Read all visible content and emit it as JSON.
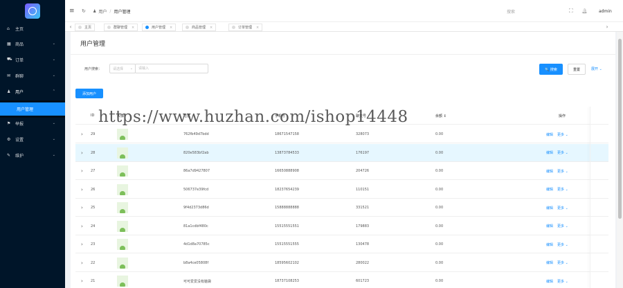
{
  "sidebar": {
    "items": [
      {
        "label": "主页",
        "icon": "home-icon",
        "glyph": "⌂",
        "arrow": ""
      },
      {
        "label": "商品",
        "icon": "goods-icon",
        "glyph": "▦",
        "arrow": "⌄"
      },
      {
        "label": "订单",
        "icon": "cart-icon",
        "glyph": "⛟",
        "arrow": "⌄"
      },
      {
        "label": "群聊",
        "icon": "chat-icon",
        "glyph": "✉",
        "arrow": "⌄"
      },
      {
        "label": "用户",
        "icon": "user-icon",
        "glyph": "♟",
        "arrow": "⌃"
      },
      {
        "label": "举报",
        "icon": "report-icon",
        "glyph": "⚑",
        "arrow": "⌄"
      },
      {
        "label": "设置",
        "icon": "settings-icon",
        "glyph": "⚙",
        "arrow": "⌄"
      },
      {
        "label": "维护",
        "icon": "wrench-icon",
        "glyph": "✎",
        "arrow": "⌄"
      }
    ],
    "sub_active": "用户管理"
  },
  "header": {
    "menu_icon": "≡",
    "refresh_icon": "↻",
    "crumb_parent": "用户",
    "crumb_sep": "/",
    "crumb_current": "用户管理",
    "search_label": "搜索",
    "fullscreen_icon": "⛶",
    "bell_icon": "🔔",
    "username": "admin"
  },
  "tabs": {
    "prev": "‹",
    "next": "›",
    "items": [
      {
        "label": "主页"
      },
      {
        "label": "群聊管理"
      },
      {
        "label": "用户管理"
      },
      {
        "label": "商品管理"
      },
      {
        "label": "订单管理"
      }
    ],
    "close": "×"
  },
  "page": {
    "title": "用户管理",
    "search_label": "用户搜索：",
    "select_value": "请选择",
    "select_chev": "⌄",
    "input_placeholder": "请输入",
    "search_button": "🔍 搜索",
    "reset_button": "重置",
    "expand_link": "展开 ⌄",
    "add_button": "添加用户",
    "watermark": "https://www.huzhan.com/ishop14448"
  },
  "table": {
    "headers": {
      "id": "ID",
      "avatar": "头像",
      "name": "姓名",
      "phone": "手机号",
      "account": "聊天号",
      "balance": "余额 ↕",
      "ops": "操作"
    },
    "edit_label": "编辑",
    "more_label": "更多 ⌄",
    "expand_glyph": "›",
    "rows": [
      {
        "id": "29",
        "name": "762fb49d7bdd",
        "phone": "18671547158",
        "account": "328073",
        "balance": "0.00"
      },
      {
        "id": "28",
        "name": "820e583bf2ab",
        "phone": "13873784533",
        "account": "176197",
        "balance": "0.00"
      },
      {
        "id": "27",
        "name": "86a7d9427807",
        "phone": "16650888908",
        "account": "204726",
        "balance": "0.00"
      },
      {
        "id": "26",
        "name": "506737e39fcd",
        "phone": "18237654239",
        "account": "110151",
        "balance": "0.00"
      },
      {
        "id": "25",
        "name": "9f4d2373d86d",
        "phone": "15888888888",
        "account": "331521",
        "balance": "0.00"
      },
      {
        "id": "24",
        "name": "81a1cdbf480c",
        "phone": "15515551551",
        "account": "179883",
        "balance": "0.00"
      },
      {
        "id": "23",
        "name": "4d1d8a70785c",
        "phone": "15515551555",
        "account": "130478",
        "balance": "0.00"
      },
      {
        "id": "22",
        "name": "b8a4ce05808f",
        "phone": "18595602102",
        "account": "280022",
        "balance": "0.00"
      },
      {
        "id": "21",
        "name": "可可爱爱没有脑袋",
        "phone": "18737108253",
        "account": "601723",
        "balance": "0.00"
      }
    ]
  }
}
